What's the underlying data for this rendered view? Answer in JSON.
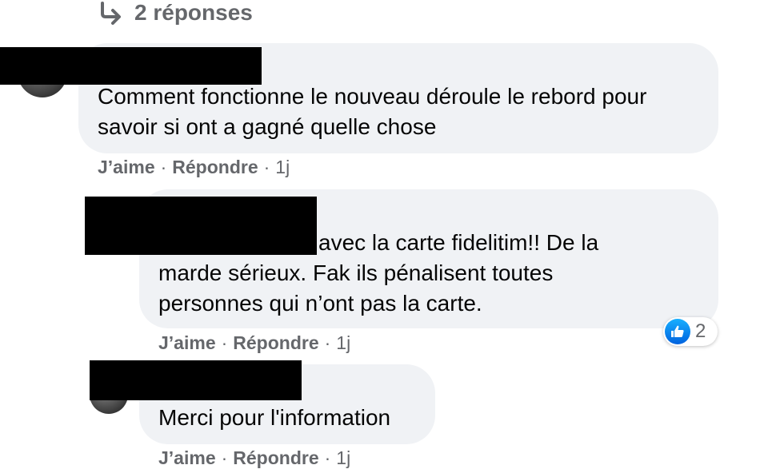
{
  "replies_toggle": {
    "label": "2 réponses"
  },
  "comments": [
    {
      "text": "Comment fonctionne le nouveau déroule le rebord pour savoir si ont a gagné quelle chose",
      "actions": {
        "like": "J’aime",
        "reply": "Répondre",
        "time": "1j"
      }
    },
    {
      "text": "avec la carte fidelitim!! De la marde sérieux. Fak ils pénalisent toutes personnes qui n’ont pas la carte.",
      "line1": "avec la carte fidelitim!! De la",
      "line2": "marde sérieux. Fak ils pénalisent toutes",
      "line3": "personnes qui n’ont pas la carte.",
      "reactions": {
        "icon": "like-icon",
        "count": "2"
      },
      "actions": {
        "like": "J’aime",
        "reply": "Répondre",
        "time": "1j"
      }
    },
    {
      "text": "Merci pour l'information",
      "actions": {
        "like": "J’aime",
        "reply": "Répondre",
        "time": "1j"
      }
    }
  ],
  "separator": "·",
  "colors": {
    "bubble": "#f0f2f5",
    "meta": "#65676b",
    "like_blue": "#1877f2"
  }
}
